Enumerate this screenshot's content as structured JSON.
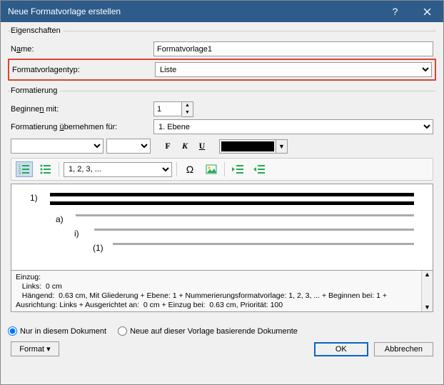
{
  "titlebar": {
    "title": "Neue Formatvorlage erstellen"
  },
  "groups": {
    "properties": "Eigenschaften",
    "formatting": "Formatierung"
  },
  "labels": {
    "name_pre": "N",
    "name_u": "a",
    "name_post": "me:",
    "type": "Formatvorlagentyp:",
    "startat_pre": "Beginne",
    "startat_u": "n",
    "startat_post": " mit:",
    "applyto_pre": "Formatierung ",
    "applyto_u": "ü",
    "applyto_post": "bernehmen für:"
  },
  "fields": {
    "name": "Formatvorlage1",
    "type": "Liste",
    "start_at": "1",
    "apply_to": "1. Ebene",
    "number_style": "1, 2, 3, ..."
  },
  "toolbar": {
    "bold": "F",
    "italic": "K",
    "underline": "U"
  },
  "preview": {
    "l1": "1)",
    "l2": "a)",
    "l3": "i)",
    "l4": "(1)"
  },
  "desc": {
    "line1": "Einzug:",
    "line2": "   Links:  0 cm",
    "line3": "   Hängend:  0.63 cm, Mit Gliederung + Ebene: 1 + Nummerierungsformatvorlage: 1, 2, 3, ... + Beginnen bei: 1 +",
    "line4": "Ausrichtung: Links + Ausgerichtet an:  0 cm + Einzug bei:  0.63 cm, Priorität: 100"
  },
  "radios": {
    "only_doc": "Nur in diesem Dokument",
    "template": "Neue auf dieser Vorlage basierende Dokumente"
  },
  "footer": {
    "format": "Format ▾",
    "ok": "OK",
    "cancel": "Abbrechen"
  }
}
